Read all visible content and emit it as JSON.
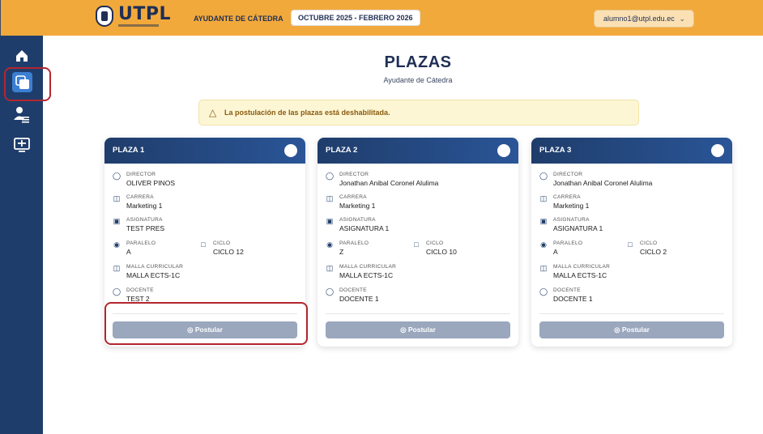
{
  "header": {
    "brand": "UTPL",
    "role": "AYUDANTE DE CÁTEDRA",
    "period": "OCTUBRE 2025 - FEBRERO 2026",
    "user_email": "alumno1@utpl.edu.ec",
    "bg_color": "#f2a93b"
  },
  "sidebar": {
    "items": [
      {
        "icon": "home-icon",
        "active": false
      },
      {
        "icon": "copy-icon",
        "active": true
      },
      {
        "icon": "user-list-icon",
        "active": false
      },
      {
        "icon": "monitor-icon",
        "active": false
      }
    ],
    "bg_color": "#1f3d6b"
  },
  "page": {
    "title": "PLAZAS",
    "subtitle": "Ayudante de Cátedra"
  },
  "alert": {
    "text": "La postulación de las plazas está deshabilitada."
  },
  "labels": {
    "director": "DIRECTOR",
    "carrera": "CARRERA",
    "asignatura": "ASIGNATURA",
    "paralelo": "PARALELO",
    "ciclo": "CICLO",
    "malla": "MALLA CURRICULAR",
    "docente": "DOCENTE",
    "postular": "Postular"
  },
  "cards": [
    {
      "title": "PLAZA 1",
      "director": "OLIVER PINOS",
      "carrera": "Marketing 1",
      "asignatura": "TEST PRES",
      "paralelo": "A",
      "ciclo": "CICLO 12",
      "malla": "MALLA ECTS-1C",
      "docente": "TEST 2"
    },
    {
      "title": "PLAZA 2",
      "director": "Jonathan Anibal Coronel Alulima",
      "carrera": "Marketing 1",
      "asignatura": "ASIGNATURA 1",
      "paralelo": "Z",
      "ciclo": "CICLO 10",
      "malla": "MALLA ECTS-1C",
      "docente": "DOCENTE 1"
    },
    {
      "title": "PLAZA 3",
      "director": "Jonathan Anibal Coronel Alulima",
      "carrera": "Marketing 1",
      "asignatura": "ASIGNATURA 1",
      "paralelo": "A",
      "ciclo": "CICLO 2",
      "malla": "MALLA ECTS-1C",
      "docente": "DOCENTE 1"
    }
  ]
}
